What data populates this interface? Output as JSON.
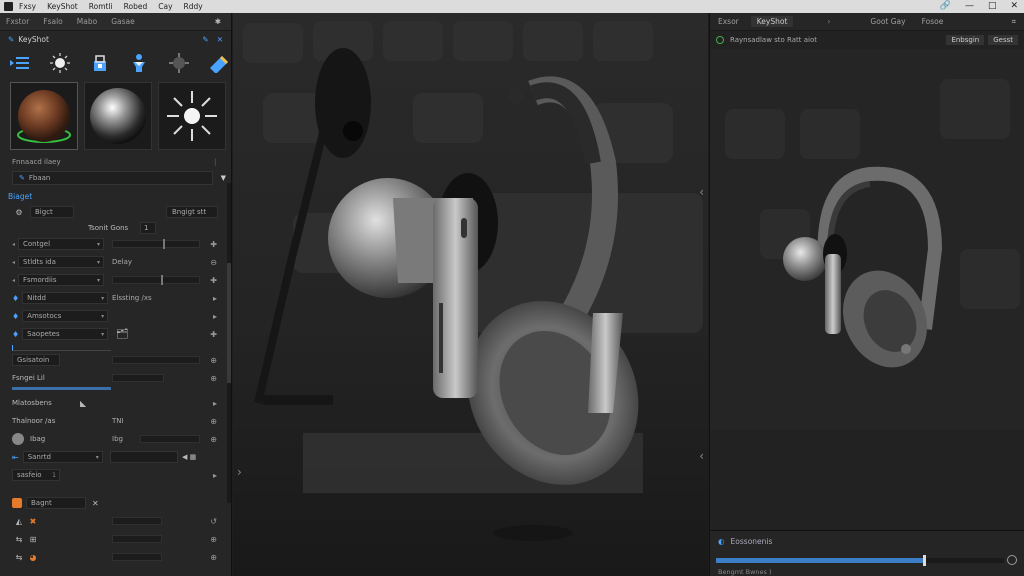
{
  "menu": {
    "items": [
      "Fxsy",
      "KeyShot",
      "Romtli",
      "Robed",
      "Cay",
      "Rddy"
    ],
    "window_controls": [
      "🔗",
      "—",
      "□",
      "✕"
    ]
  },
  "left_panel": {
    "tabs": [
      "Fxstor",
      "Fsalo",
      "Mabo",
      "Gasae"
    ],
    "tab_icon": "✱",
    "title": "KeyShot",
    "toolbar_icons": [
      "list-icon",
      "light-icon",
      "bucket-icon",
      "figure-icon",
      "sun-gear-icon",
      "tape-icon"
    ],
    "preset_label": "Fnnaacd ilaey",
    "preset_dropdown": "Fbaan",
    "section_label": "Biaget",
    "object_name": "Bigct",
    "object_button": "Bngigt stt",
    "mid_label": "Tsonit  Gons",
    "mid_value": "1",
    "rows": [
      {
        "label": "Contgel",
        "value": ""
      },
      {
        "label": "Stldts ida",
        "value": "Delay"
      },
      {
        "label": "Fsmordiis",
        "value": ""
      },
      {
        "label": "Nitdd",
        "value": "Elssting /xs"
      },
      {
        "label": "Amsotocs",
        "value": ""
      },
      {
        "label": "Saopetes",
        "value": ""
      }
    ],
    "sub_rows": [
      {
        "label": "Gsisatoin",
        "value": ""
      },
      {
        "label": "Fsngei  Lil",
        "value": ""
      },
      {
        "label": "Mlatosbens",
        "value": ""
      },
      {
        "label": "Thalnoor  /as",
        "value": "TNI"
      },
      {
        "label": "Ibag",
        "value": "Ibg"
      },
      {
        "label": "Sanrtd",
        "value": ""
      },
      {
        "label": "sasfeio",
        "value": "1"
      }
    ],
    "bottom_rows": [
      {
        "label": "Bagnt",
        "value": ""
      },
      {
        "label": "",
        "value": ""
      },
      {
        "label": "",
        "value": ""
      },
      {
        "label": "",
        "value": ""
      }
    ]
  },
  "right_panel": {
    "tabs": [
      "Exsor",
      "KeyShot",
      "Goot Gay",
      "Fosoe"
    ],
    "info": "Raynsadlaw sto  Ratt aiot",
    "btn1": "Enbsgin",
    "btn2": "Gesst",
    "progress_label": "Eossonenis",
    "progress_sub": "Bengmt  Bwnes )",
    "progress": 0.72
  },
  "colors": {
    "accent": "#4aa3ff",
    "progress": "#3c7fc6",
    "green": "#3fae49"
  }
}
